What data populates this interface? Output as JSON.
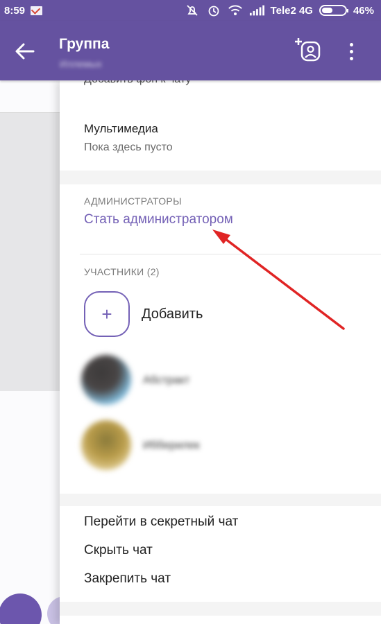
{
  "status_bar": {
    "time": "8:59",
    "carrier": "Tele2 4G",
    "battery": "46%"
  },
  "app_bar": {
    "title": "Группа",
    "subtitle": "Иллемых"
  },
  "panel": {
    "faded_item": "Добавить фон к чату",
    "media": {
      "title": "Мультимедиа",
      "subtitle": "Пока здесь пусто"
    },
    "admins": {
      "header": "АДМИНИСТРАТОРЫ",
      "become_admin": "Стать администратором"
    },
    "members": {
      "header": "УЧАСТНИКИ (2)",
      "add_label": "Добавить",
      "list": [
        {
          "name": "Абстракт"
        },
        {
          "name": "Ибберилек"
        }
      ]
    },
    "actions": {
      "secret_chat": "Перейти в секретный чат",
      "hide_chat": "Скрыть чат",
      "pin_chat": "Закрепить чат"
    }
  },
  "colors": {
    "brand": "#6552a0",
    "accent": "#7461b6",
    "annotation": "#e02424"
  },
  "icons": [
    "back-arrow-icon",
    "add-member-icon",
    "more-vert-icon",
    "mail-icon",
    "alarm-off-icon",
    "alarm-icon",
    "wifi-icon",
    "signal-icon",
    "battery-icon",
    "plus-icon"
  ]
}
